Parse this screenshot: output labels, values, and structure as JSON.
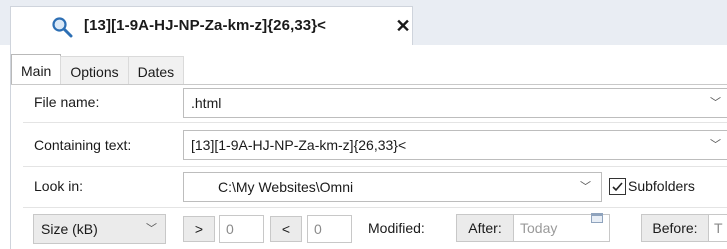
{
  "tab": {
    "title": "[13][1-9A-HJ-NP-Za-km-z]{26,33}<",
    "close_glyph": "✕",
    "icon": "search-icon"
  },
  "subtabs": [
    "Main",
    "Options",
    "Dates"
  ],
  "form": {
    "file_name_label": "File name:",
    "file_name_value": ".html",
    "containing_text_label": "Containing text:",
    "containing_text_value": "[13][1-9A-HJ-NP-Za-km-z]{26,33}<",
    "look_in_label": "Look in:",
    "look_in_value": "C:\\My Websites\\Omni",
    "subfolders_label": "Subfolders",
    "subfolders_checked": true,
    "size_unit": "Size (kB)",
    "gt_label": ">",
    "gt_value": "0",
    "lt_label": "<",
    "lt_value": "0",
    "modified_label": "Modified:",
    "after_label": "After:",
    "after_placeholder": "Today",
    "before_label": "Before:",
    "before_value": "T"
  },
  "colors": {
    "topbar": "#e9edf3",
    "button": "#ebebeb",
    "border": "#bdbdbd"
  }
}
